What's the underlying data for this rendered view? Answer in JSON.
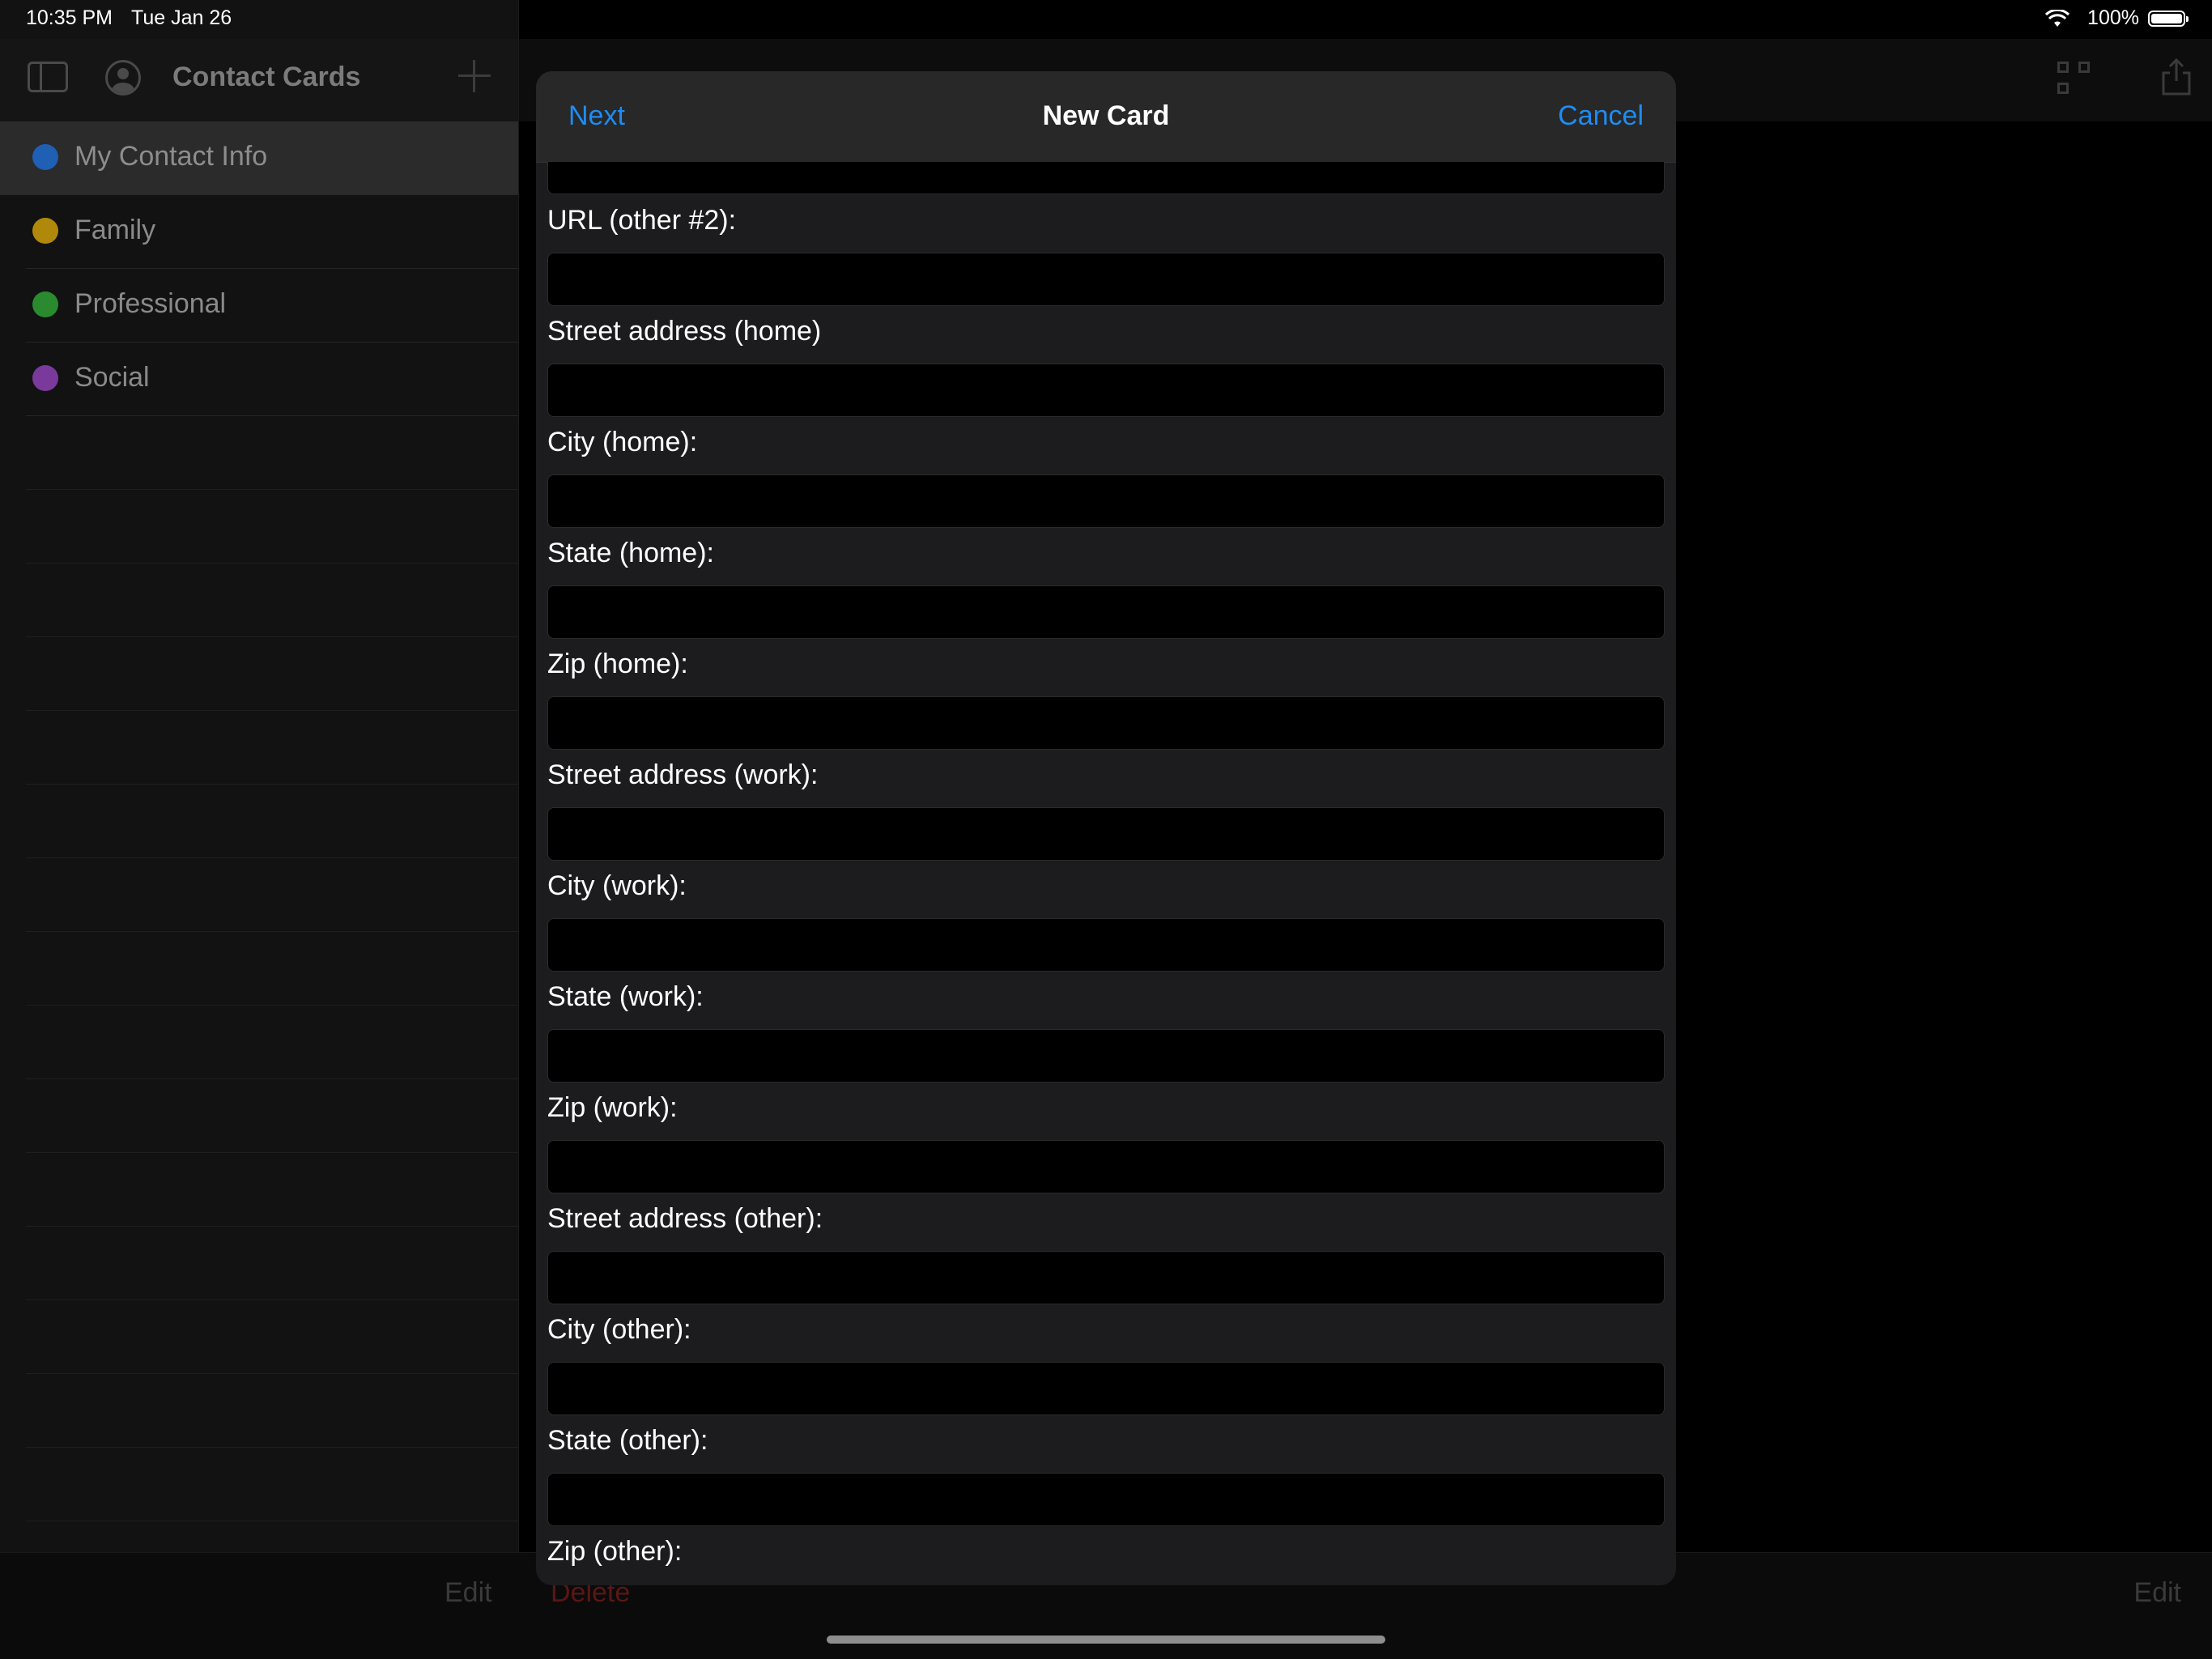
{
  "status_bar": {
    "time": "10:35 PM",
    "date": "Tue Jan 26",
    "battery": "100%"
  },
  "sidebar": {
    "title": "Contact Cards",
    "items": [
      {
        "label": "My Contact Info",
        "color": "#1f5fb4"
      },
      {
        "label": "Family",
        "color": "#b0890b"
      },
      {
        "label": "Professional",
        "color": "#2a8a2f"
      },
      {
        "label": "Social",
        "color": "#7a3a9c"
      }
    ]
  },
  "bottom_toolbar": {
    "edit_left": "Edit",
    "delete": "Delete",
    "edit_right": "Edit"
  },
  "modal": {
    "title": "New Card",
    "next": "Next",
    "cancel": "Cancel",
    "fields": [
      {
        "label": "URL (other #2):",
        "value": ""
      },
      {
        "label": "Street address (home)",
        "value": ""
      },
      {
        "label": "City (home):",
        "value": ""
      },
      {
        "label": "State (home):",
        "value": ""
      },
      {
        "label": "Zip (home):",
        "value": ""
      },
      {
        "label": "Street address (work):",
        "value": ""
      },
      {
        "label": "City (work):",
        "value": ""
      },
      {
        "label": "State (work):",
        "value": ""
      },
      {
        "label": "Zip (work):",
        "value": ""
      },
      {
        "label": "Street address (other):",
        "value": ""
      },
      {
        "label": "City (other):",
        "value": ""
      },
      {
        "label": "State (other):",
        "value": ""
      },
      {
        "label": "Zip (other):",
        "value": ""
      }
    ]
  }
}
